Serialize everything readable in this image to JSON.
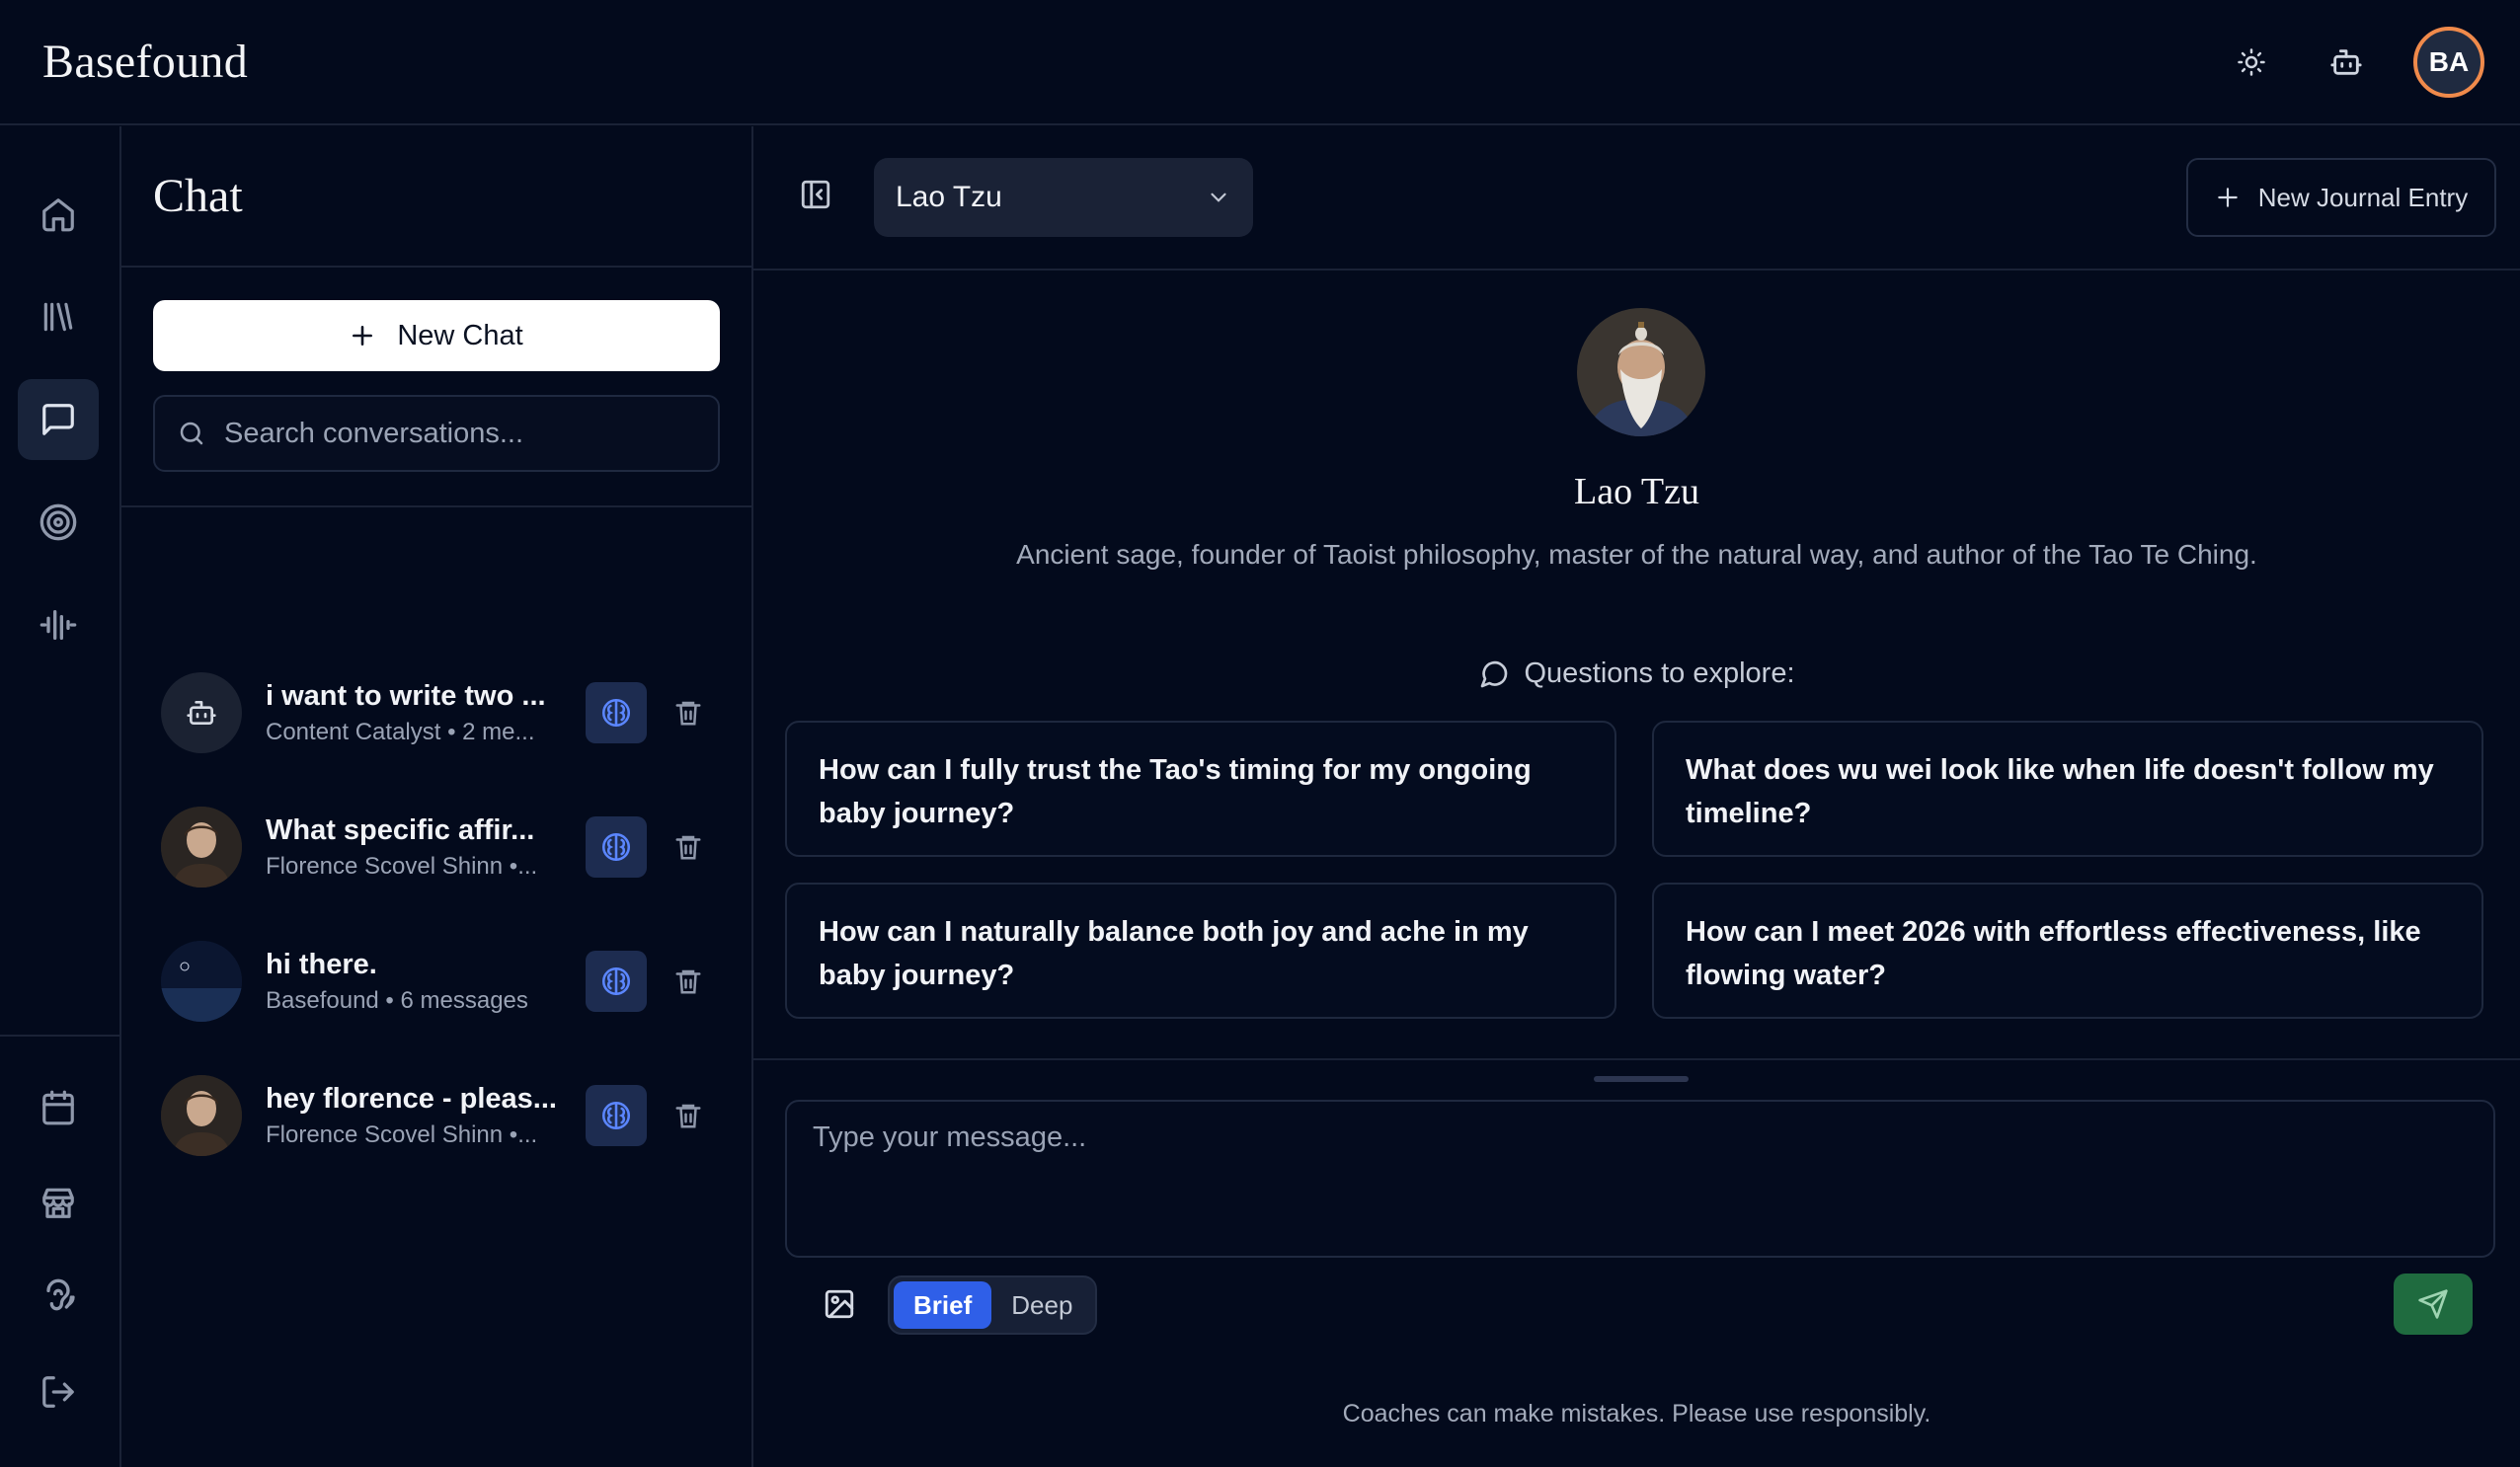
{
  "app": {
    "brand": "Basefound",
    "user_initials": "BA"
  },
  "topbar": {
    "theme_icon": "sun-icon",
    "bot_icon": "bot-icon"
  },
  "rail": {
    "top_items": [
      {
        "icon": "home-icon"
      },
      {
        "icon": "library-icon"
      },
      {
        "icon": "chat-icon",
        "active": true
      },
      {
        "icon": "target-icon"
      },
      {
        "icon": "audio-wave-icon"
      }
    ],
    "bottom_items": [
      {
        "icon": "calendar-icon"
      },
      {
        "icon": "store-icon"
      },
      {
        "icon": "voice-icon"
      },
      {
        "icon": "logout-icon"
      }
    ]
  },
  "chat_panel": {
    "title": "Chat",
    "new_chat_label": "New Chat",
    "search_placeholder": "Search conversations...",
    "conversations": [
      {
        "title": "i want to write two ...",
        "subtitle": "Content Catalyst • 2 me..."
      },
      {
        "title": "What specific affir...",
        "subtitle": "Florence Scovel Shinn •..."
      },
      {
        "title": "hi there.",
        "subtitle": "Basefound • 6 messages"
      },
      {
        "title": "hey florence - pleas...",
        "subtitle": "Florence Scovel Shinn •..."
      }
    ]
  },
  "main": {
    "selected_coach": "Lao Tzu",
    "journal_button": "New Journal Entry",
    "coach_name": "Lao Tzu",
    "coach_description": "Ancient sage, founder of Taoist philosophy, master of the natural way, and author of the Tao Te Ching.",
    "explore_label": "Questions to explore:",
    "questions": [
      "How can I fully trust the Tao's timing for my ongoing baby journey?",
      "What does wu wei look like when life doesn't follow my timeline?",
      "How can I naturally balance both joy and ache in my baby journey?",
      "How can I meet 2026 with effortless effectiveness, like flowing water?"
    ],
    "message_placeholder": "Type your message...",
    "modes": [
      "Brief",
      "Deep"
    ],
    "active_mode": "Brief",
    "disclaimer": "Coaches can make mistakes. Please use responsibly."
  }
}
